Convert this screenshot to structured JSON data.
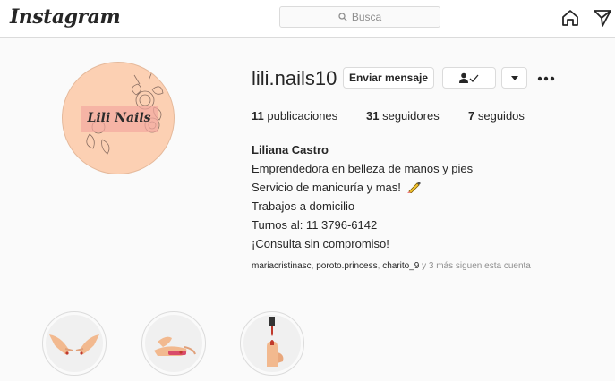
{
  "header": {
    "logo": "Instagram",
    "search_placeholder": "Busca",
    "icons": [
      "home-icon",
      "direct-message-icon"
    ]
  },
  "avatar": {
    "label": "Lili Nails"
  },
  "profile": {
    "username": "lili.nails10",
    "message_button": "Enviar mensaje",
    "follow_icon": "person-check-icon",
    "dropdown_icon": "caret-down-icon",
    "more_icon": "more-dots-icon"
  },
  "stats": {
    "posts_count": "11",
    "posts_label": "publicaciones",
    "followers_count": "31",
    "followers_label": "seguidores",
    "following_count": "7",
    "following_label": "seguidos"
  },
  "bio": {
    "full_name": "Liliana Castro",
    "lines": [
      "Emprendedora en belleza de manos y pies",
      "Servicio de manicuría y mas!",
      "Trabajos a domicilio",
      "Turnos al: 11 3796-6142",
      "¡Consulta sin compromiso!"
    ]
  },
  "followed_by": {
    "user1": "mariacristinasc",
    "sep1": ", ",
    "user2": "poroto.princess",
    "sep2": ", ",
    "user3": "charito_9",
    "rest": " y 3 más siguen esta cuenta"
  },
  "highlights": [
    "highlight-hands",
    "highlight-nail-care",
    "highlight-nail-polish"
  ],
  "colors": {
    "avatar_bg": "#fcd0b3",
    "nail": "#c0392b",
    "text": "#262626",
    "muted": "#8e8e8e"
  }
}
